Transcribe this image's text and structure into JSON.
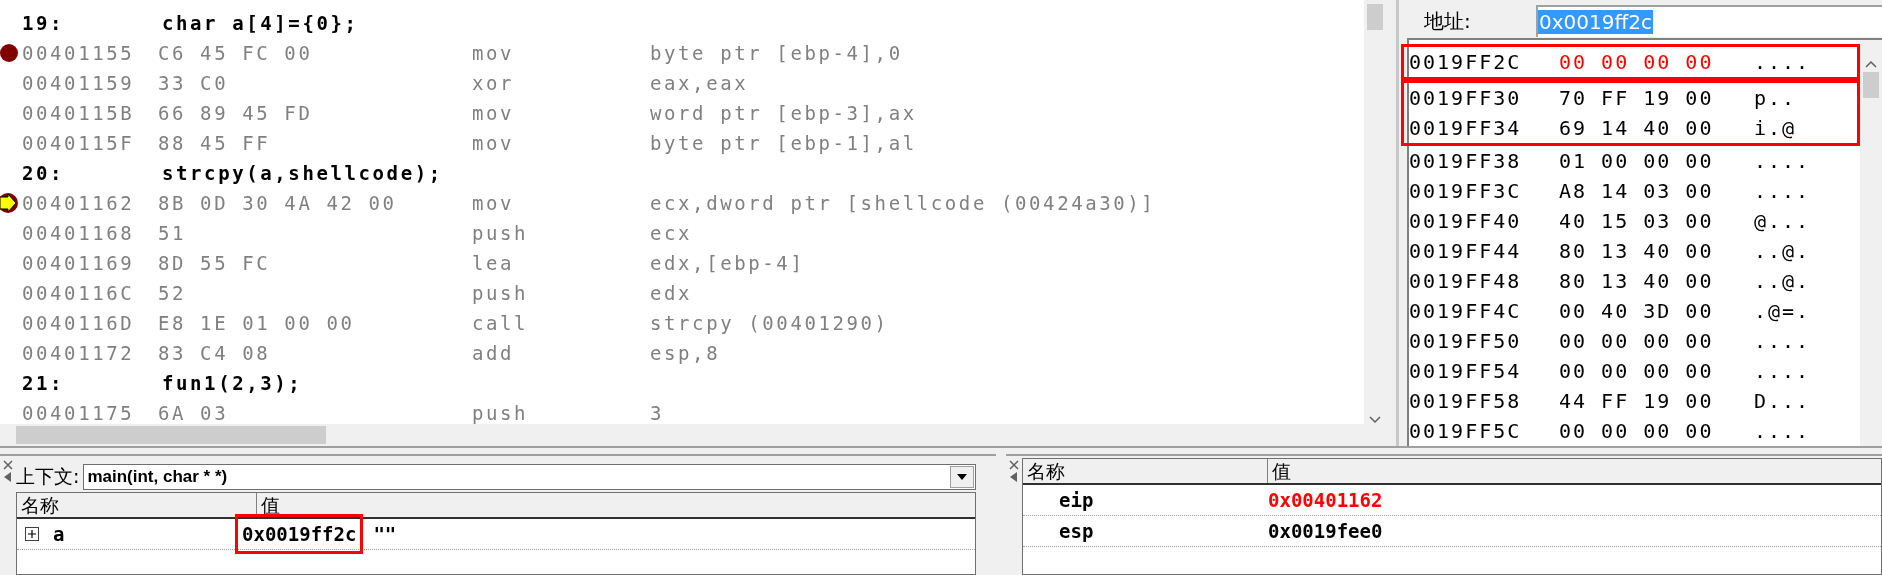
{
  "disassembly": {
    "lines": [
      {
        "kind": "source",
        "line_no": "19:",
        "code": "char a[4]={0};"
      },
      {
        "kind": "asm",
        "address": "00401155",
        "bytes": "C6 45 FC 00",
        "mnemonic": "mov",
        "operands": "byte ptr [ebp-4],0",
        "breakpoint": true,
        "current": false
      },
      {
        "kind": "asm",
        "address": "00401159",
        "bytes": "33 C0",
        "mnemonic": "xor",
        "operands": "eax,eax",
        "breakpoint": false,
        "current": false
      },
      {
        "kind": "asm",
        "address": "0040115B",
        "bytes": "66 89 45 FD",
        "mnemonic": "mov",
        "operands": "word ptr [ebp-3],ax",
        "breakpoint": false,
        "current": false
      },
      {
        "kind": "asm",
        "address": "0040115F",
        "bytes": "88 45 FF",
        "mnemonic": "mov",
        "operands": "byte ptr [ebp-1],al",
        "breakpoint": false,
        "current": false
      },
      {
        "kind": "source",
        "line_no": "20:",
        "code": "strcpy(a,shellcode);"
      },
      {
        "kind": "asm",
        "address": "00401162",
        "bytes": "8B 0D 30 4A 42 00",
        "mnemonic": "mov",
        "operands": "ecx,dword ptr [shellcode (00424a30)]",
        "breakpoint": true,
        "current": true
      },
      {
        "kind": "asm",
        "address": "00401168",
        "bytes": "51",
        "mnemonic": "push",
        "operands": "ecx",
        "breakpoint": false,
        "current": false
      },
      {
        "kind": "asm",
        "address": "00401169",
        "bytes": "8D 55 FC",
        "mnemonic": "lea",
        "operands": "edx,[ebp-4]",
        "breakpoint": false,
        "current": false
      },
      {
        "kind": "asm",
        "address": "0040116C",
        "bytes": "52",
        "mnemonic": "push",
        "operands": "edx",
        "breakpoint": false,
        "current": false
      },
      {
        "kind": "asm",
        "address": "0040116D",
        "bytes": "E8 1E 01 00 00",
        "mnemonic": "call",
        "operands": "strcpy (00401290)",
        "breakpoint": false,
        "current": false
      },
      {
        "kind": "asm",
        "address": "00401172",
        "bytes": "83 C4 08",
        "mnemonic": "add",
        "operands": "esp,8",
        "breakpoint": false,
        "current": false
      },
      {
        "kind": "source",
        "line_no": "21:",
        "code": "fun1(2,3);"
      },
      {
        "kind": "asm",
        "address": "00401175",
        "bytes": "6A 03",
        "mnemonic": "push",
        "operands": "3",
        "breakpoint": false,
        "current": false
      }
    ]
  },
  "memory": {
    "address_label": "地址:",
    "address_value": "0x0019ff2c",
    "rows": [
      {
        "address": "0019FF2C",
        "bytes": "00 00 00 00",
        "ascii": "....",
        "changed": true,
        "boxed": true
      },
      {
        "address": "0019FF30",
        "bytes": "70 FF 19 00",
        "ascii": "p..",
        "changed": false,
        "boxed": true,
        "box_start": true
      },
      {
        "address": "0019FF34",
        "bytes": "69 14 40 00",
        "ascii": "i.@",
        "changed": false,
        "boxed": true,
        "box_start": false
      },
      {
        "address": "0019FF38",
        "bytes": "01 00 00 00",
        "ascii": "....",
        "changed": false,
        "boxed": false
      },
      {
        "address": "0019FF3C",
        "bytes": "A8 14 03 00",
        "ascii": "....",
        "changed": false,
        "boxed": false
      },
      {
        "address": "0019FF40",
        "bytes": "40 15 03 00",
        "ascii": "@...",
        "changed": false,
        "boxed": false
      },
      {
        "address": "0019FF44",
        "bytes": "80 13 40 00",
        "ascii": "..@.",
        "changed": false,
        "boxed": false
      },
      {
        "address": "0019FF48",
        "bytes": "80 13 40 00",
        "ascii": "..@.",
        "changed": false,
        "boxed": false
      },
      {
        "address": "0019FF4C",
        "bytes": "00 40 3D 00",
        "ascii": ".@=.",
        "changed": false,
        "boxed": false
      },
      {
        "address": "0019FF50",
        "bytes": "00 00 00 00",
        "ascii": "....",
        "changed": false,
        "boxed": false
      },
      {
        "address": "0019FF54",
        "bytes": "00 00 00 00",
        "ascii": "....",
        "changed": false,
        "boxed": false
      },
      {
        "address": "0019FF58",
        "bytes": "44 FF 19 00",
        "ascii": "D...",
        "changed": false,
        "boxed": false
      },
      {
        "address": "0019FF5C",
        "bytes": "00 00 00 00",
        "ascii": "....",
        "changed": false,
        "boxed": false
      }
    ]
  },
  "variables": {
    "context_label": "上下文:",
    "context_value": "main(int, char * *)",
    "columns": [
      "名称",
      "值"
    ],
    "rows": [
      {
        "name": "a",
        "value": "0x0019ff2c",
        "extra": "\"\"",
        "expanded": false,
        "boxed": true
      }
    ]
  },
  "registers": {
    "columns": [
      "名称",
      "值"
    ],
    "rows": [
      {
        "name": "eip",
        "value": "0x00401162",
        "changed": true
      },
      {
        "name": "esp",
        "value": "0x0019fee0",
        "changed": false
      }
    ]
  }
}
